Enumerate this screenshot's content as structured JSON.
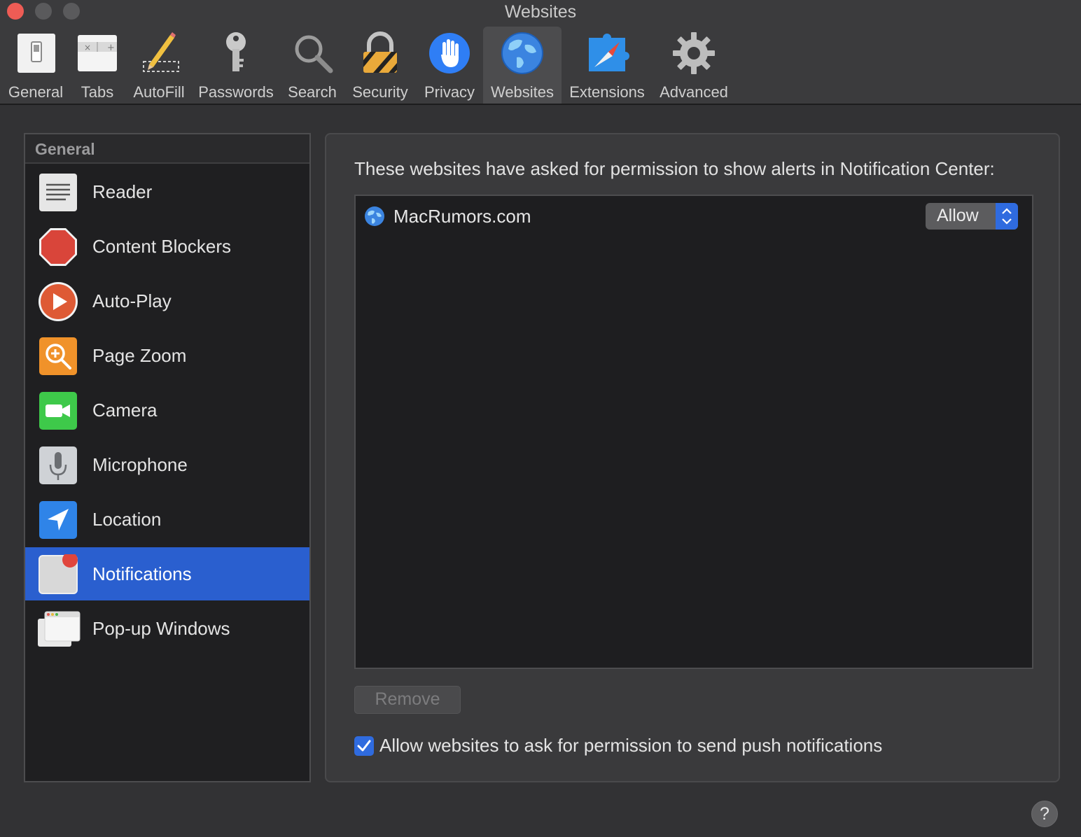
{
  "window": {
    "title": "Websites"
  },
  "toolbar": {
    "items": [
      {
        "label": "General",
        "icon": "general-switch-icon"
      },
      {
        "label": "Tabs",
        "icon": "tabs-icon"
      },
      {
        "label": "AutoFill",
        "icon": "autofill-pencil-icon"
      },
      {
        "label": "Passwords",
        "icon": "key-icon"
      },
      {
        "label": "Search",
        "icon": "magnifier-icon"
      },
      {
        "label": "Security",
        "icon": "lock-icon"
      },
      {
        "label": "Privacy",
        "icon": "hand-icon"
      },
      {
        "label": "Websites",
        "icon": "globe-icon"
      },
      {
        "label": "Extensions",
        "icon": "puzzle-compass-icon"
      },
      {
        "label": "Advanced",
        "icon": "gear-icon"
      }
    ],
    "active": "Websites"
  },
  "sidebar": {
    "header": "General",
    "items": [
      {
        "label": "Reader",
        "icon": "reader-icon"
      },
      {
        "label": "Content Blockers",
        "icon": "stop-sign-icon"
      },
      {
        "label": "Auto-Play",
        "icon": "play-icon"
      },
      {
        "label": "Page Zoom",
        "icon": "zoom-icon"
      },
      {
        "label": "Camera",
        "icon": "camera-icon"
      },
      {
        "label": "Microphone",
        "icon": "microphone-icon"
      },
      {
        "label": "Location",
        "icon": "location-arrow-icon"
      },
      {
        "label": "Notifications",
        "icon": "notification-badge-icon"
      },
      {
        "label": "Pop-up Windows",
        "icon": "popup-windows-icon"
      }
    ],
    "selected": "Notifications"
  },
  "panel": {
    "description": "These websites have asked for permission to show alerts in Notification Center:",
    "sites": [
      {
        "name": "MacRumors.com",
        "setting": "Allow"
      }
    ],
    "remove_label": "Remove",
    "checkbox_label": "Allow websites to ask for permission to send push notifications",
    "checkbox_checked": true
  },
  "help_label": "?",
  "colors": {
    "accent": "#2f6bdf",
    "selection": "#2a5fcf",
    "close": "#ee5c55"
  }
}
